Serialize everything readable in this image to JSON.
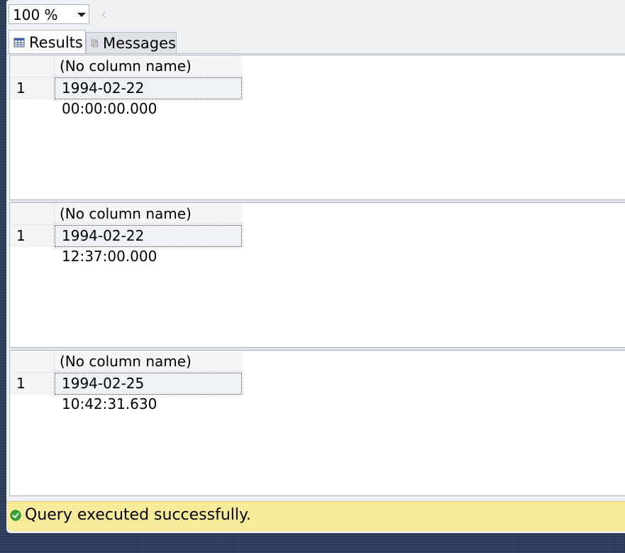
{
  "toolbar": {
    "zoom_value": "100 %",
    "scroll_left_glyph": "‹"
  },
  "tabs": [
    {
      "label": "Results",
      "icon": "grid-icon",
      "selected": true
    },
    {
      "label": "Messages",
      "icon": "messages-icon",
      "selected": false
    }
  ],
  "result_sets": [
    {
      "column_header": "(No column name)",
      "rows": [
        {
          "row_number": "1",
          "value": "1994-02-22 00:00:00.000"
        }
      ]
    },
    {
      "column_header": "(No column name)",
      "rows": [
        {
          "row_number": "1",
          "value": "1994-02-22 12:37:00.000"
        }
      ]
    },
    {
      "column_header": "(No column name)",
      "rows": [
        {
          "row_number": "1",
          "value": "1994-02-25 10:42:31.630"
        }
      ]
    }
  ],
  "status": {
    "text": "Query executed successfully.",
    "icon": "check-circle-icon",
    "color": "#f5eb99"
  }
}
